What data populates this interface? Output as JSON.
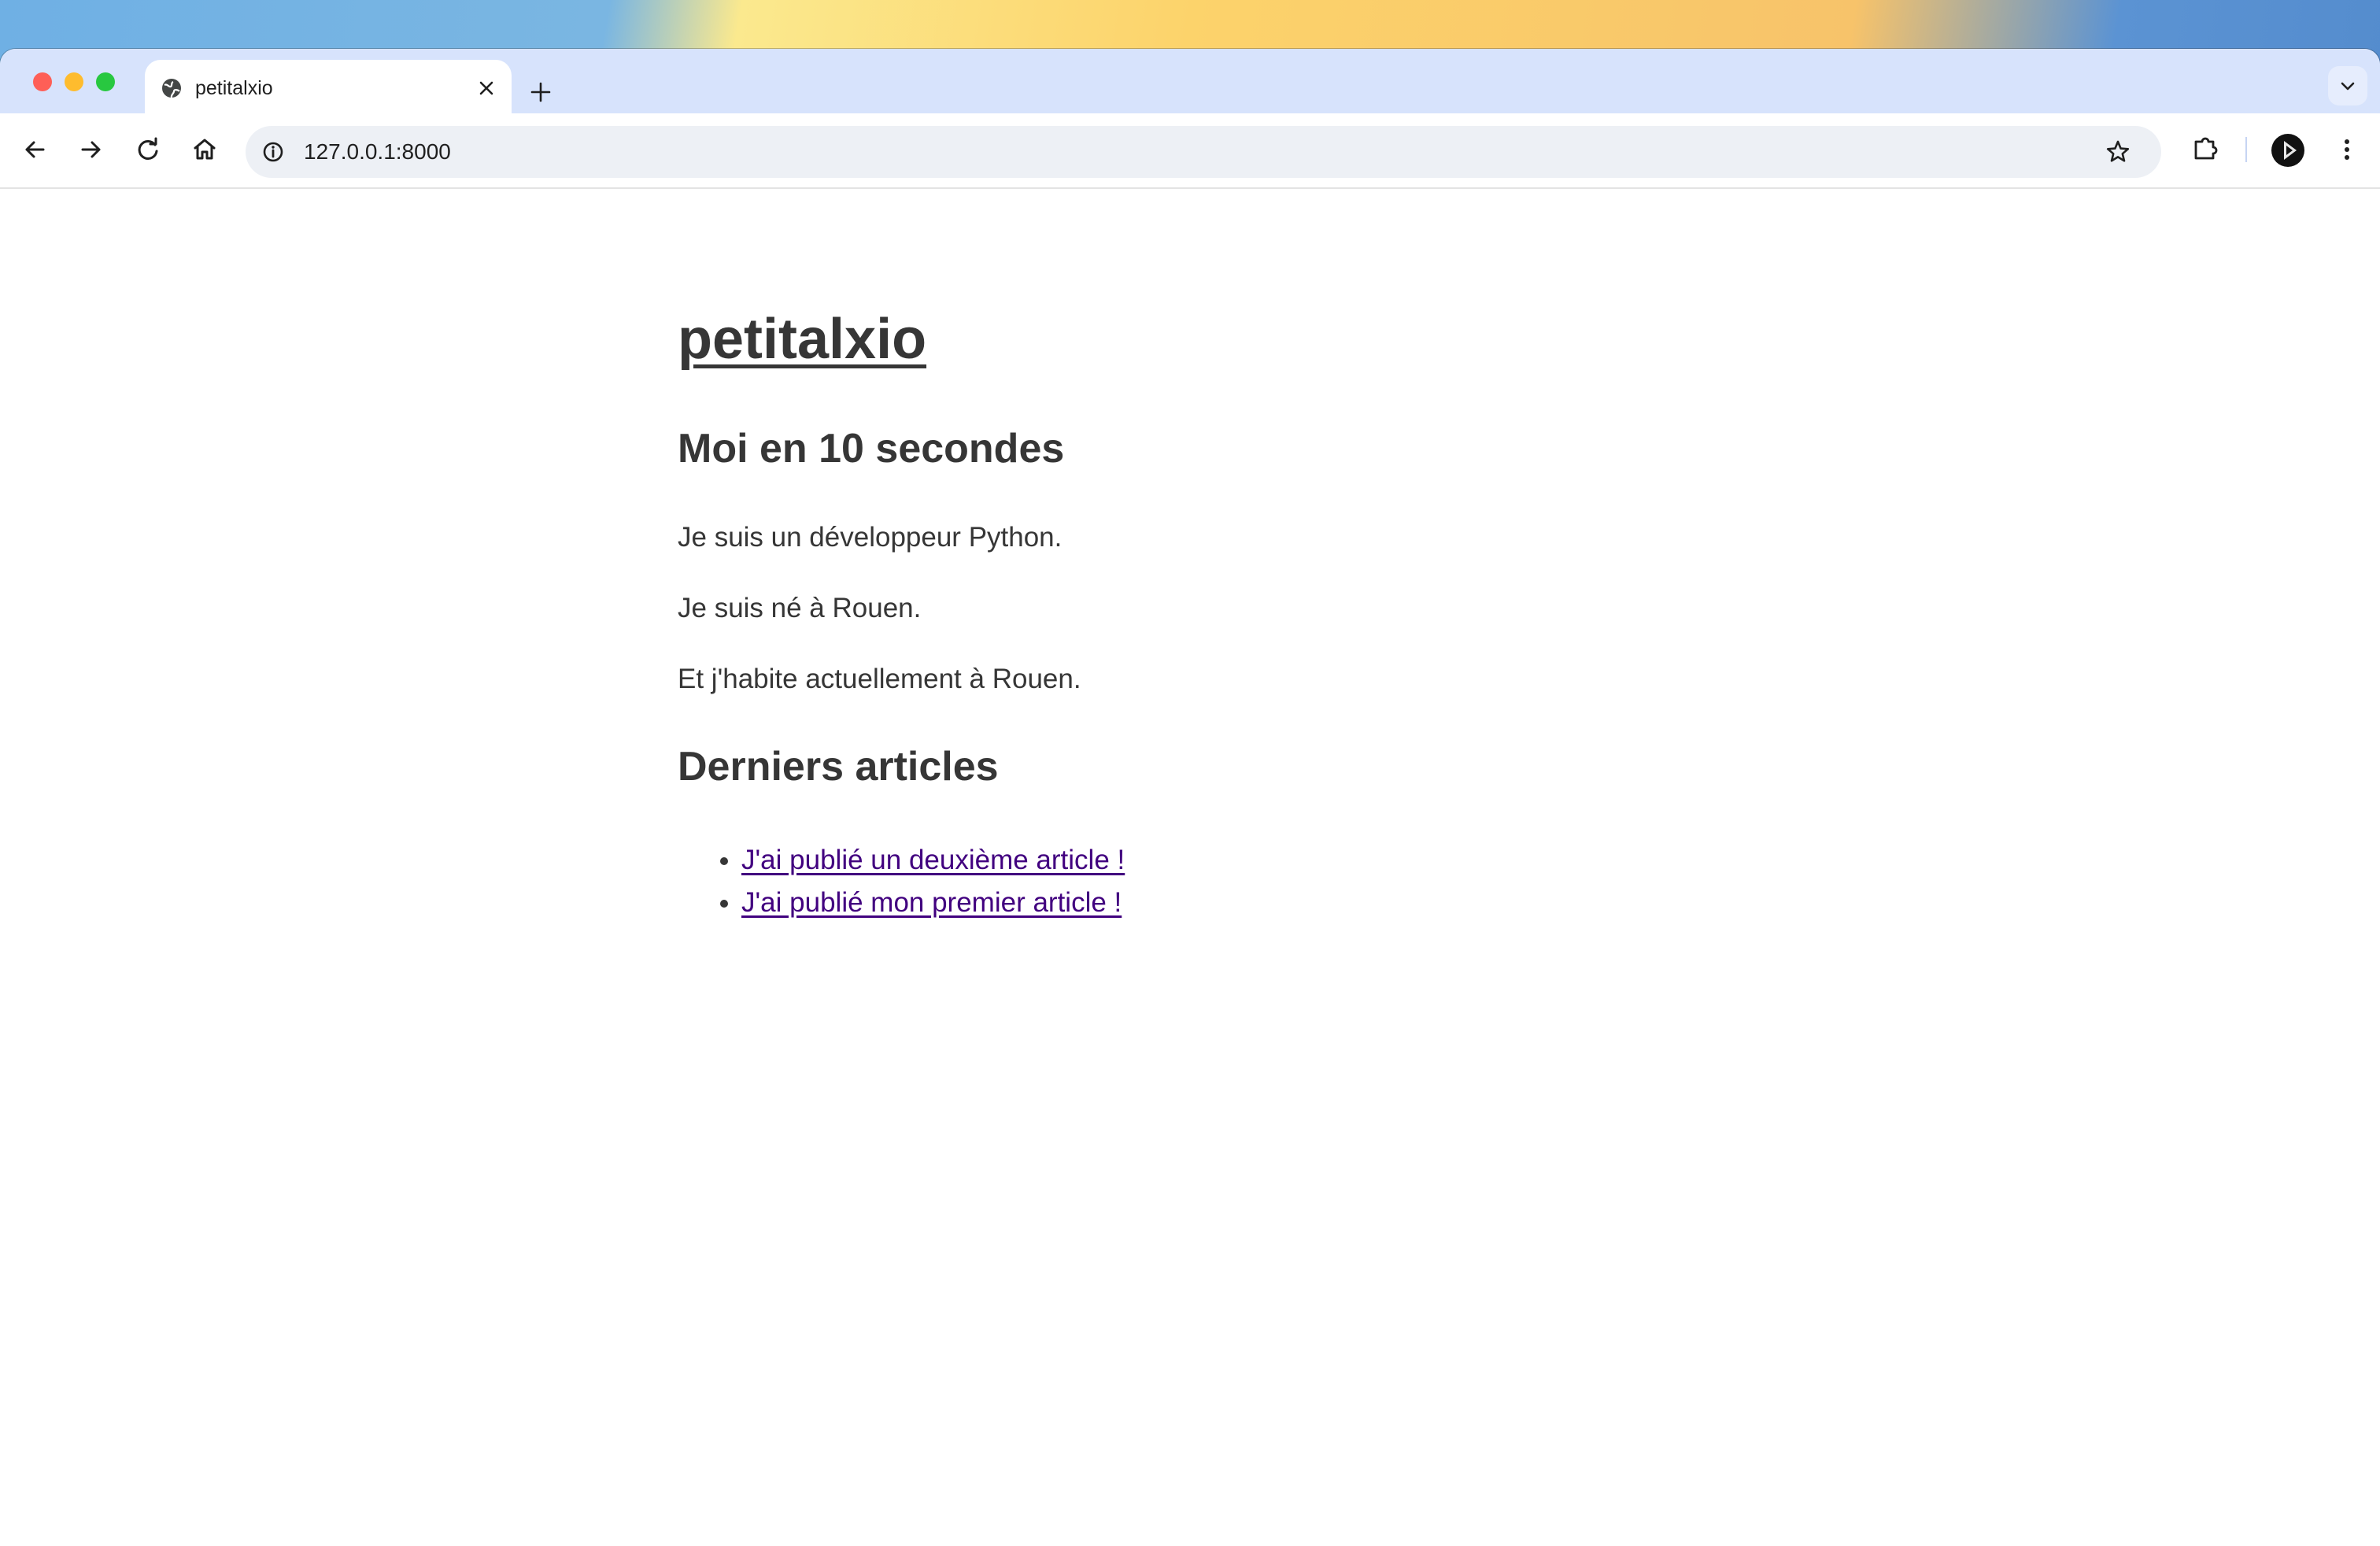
{
  "browser": {
    "tab_title": "petitalxio",
    "url": "127.0.0.1:8000"
  },
  "page": {
    "site_title": "petitalxio",
    "about_heading": "Moi en 10 secondes",
    "paragraphs": [
      "Je suis un développeur Python.",
      "Je suis né à Rouen.",
      "Et j'habite actuellement à Rouen."
    ],
    "articles_heading": "Derniers articles",
    "articles": [
      "J'ai publié un deuxième article !",
      "J'ai publié mon premier article !"
    ]
  },
  "colors": {
    "text": "#363636",
    "visited_link": "#41007f",
    "tabstrip": "#d7e3fc",
    "omnibox": "#edf0f5"
  },
  "icons": {
    "tab_favicon": "globe-icon",
    "back": "arrow-left-icon",
    "forward": "arrow-right-icon",
    "reload": "reload-icon",
    "home": "home-icon",
    "site_info": "info-icon",
    "bookmark": "star-icon",
    "extensions": "puzzle-icon",
    "menu": "kebab-menu-icon"
  }
}
